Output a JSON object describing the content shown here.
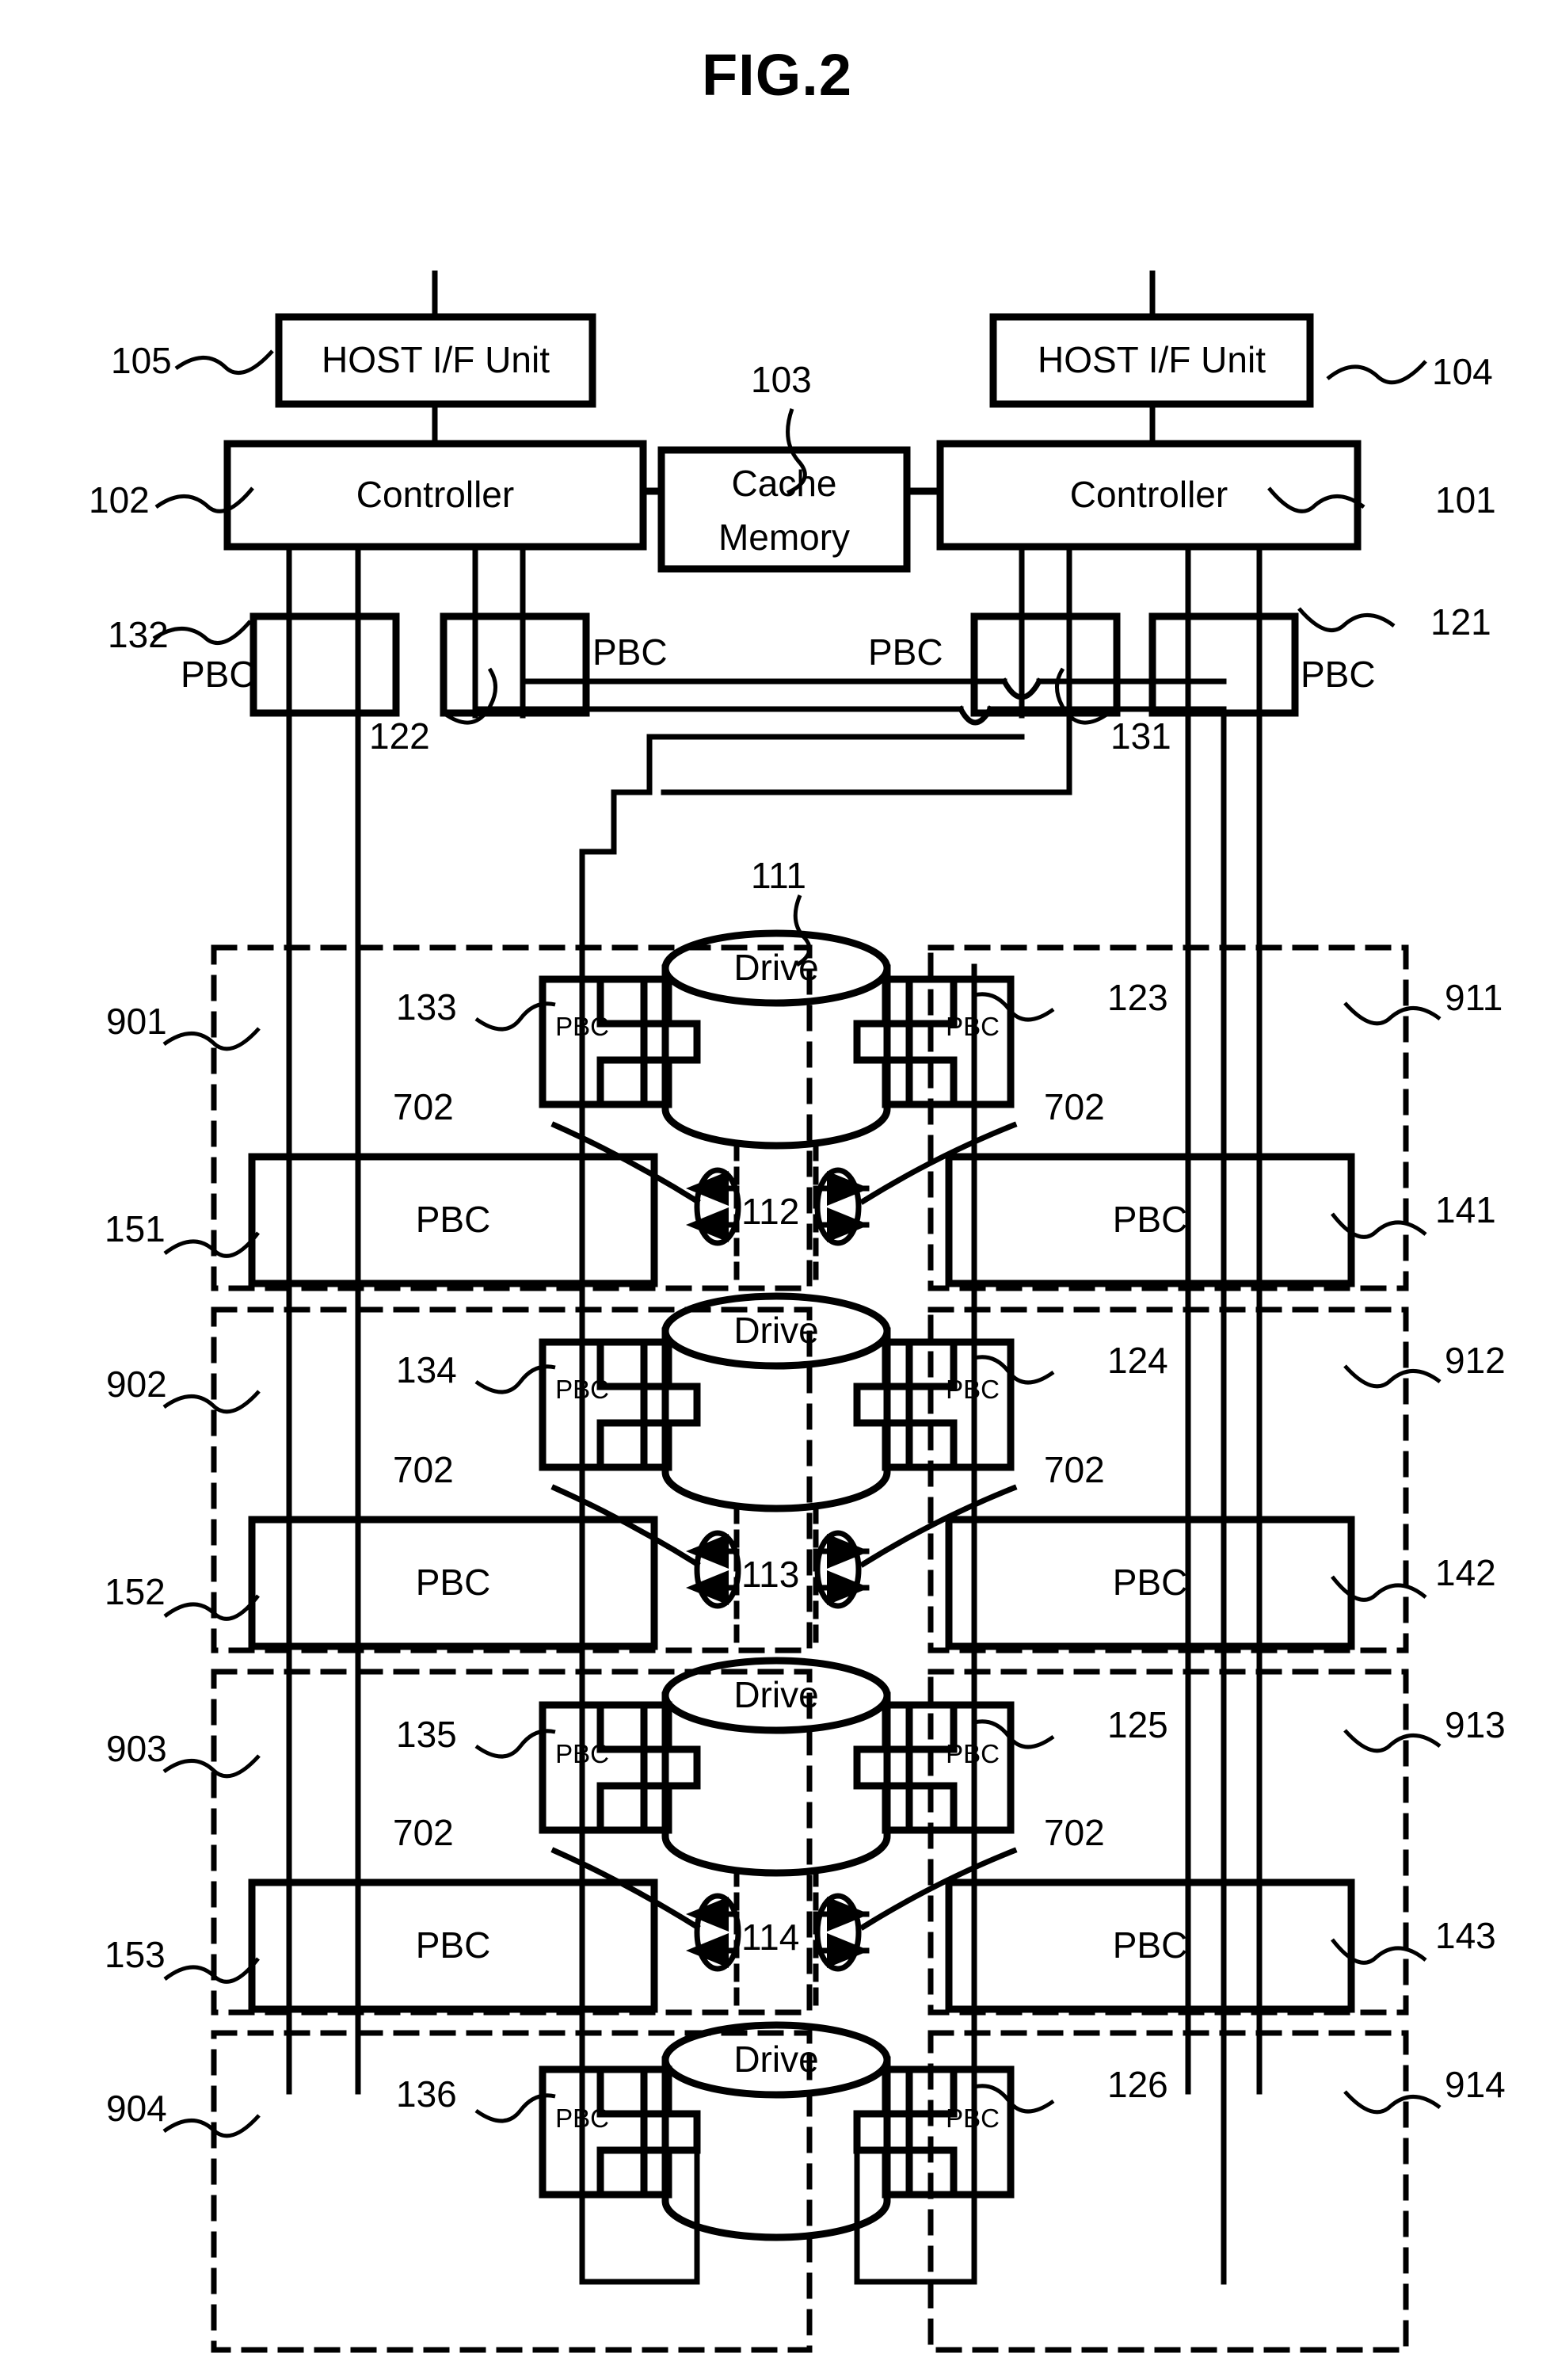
{
  "figure": {
    "title": "FIG.2"
  },
  "top": {
    "host_if_left": {
      "label": "HOST I/F Unit",
      "ref": "105"
    },
    "host_if_right": {
      "label": "HOST I/F Unit",
      "ref": "104"
    },
    "controller_left": {
      "label": "Controller",
      "ref": "102"
    },
    "controller_right": {
      "label": "Controller",
      "ref": "101"
    },
    "cache": {
      "label": "Cache\nMemory",
      "line1": "Cache",
      "line2": "Memory",
      "ref": "103"
    }
  },
  "controller_pbcs": [
    {
      "label": "PBC",
      "ref": "132",
      "side": "left"
    },
    {
      "label": "PBC",
      "ref": "122",
      "side": "left"
    },
    {
      "label": "PBC",
      "ref": "131",
      "side": "right"
    },
    {
      "label": "PBC",
      "ref": "121",
      "side": "right"
    }
  ],
  "drive_groups": [
    {
      "drive": {
        "label": "Drive",
        "ref": "111"
      },
      "left_enclosure_ref": "901",
      "right_enclosure_ref": "911",
      "left_drive_pbc": {
        "label": "PBC",
        "ref": "133"
      },
      "right_drive_pbc": {
        "label": "PBC",
        "ref": "123"
      },
      "left_wide_pbc": {
        "label": "PBC",
        "ref": "151"
      },
      "right_wide_pbc": {
        "label": "PBC",
        "ref": "141"
      },
      "link_ref": "112",
      "port_ref_left": "702",
      "port_ref_right": "702"
    },
    {
      "drive": {
        "label": "Drive",
        "ref": ""
      },
      "left_enclosure_ref": "902",
      "right_enclosure_ref": "912",
      "left_drive_pbc": {
        "label": "PBC",
        "ref": "134"
      },
      "right_drive_pbc": {
        "label": "PBC",
        "ref": "124"
      },
      "left_wide_pbc": {
        "label": "PBC",
        "ref": "152"
      },
      "right_wide_pbc": {
        "label": "PBC",
        "ref": "142"
      },
      "link_ref": "113",
      "port_ref_left": "702",
      "port_ref_right": "702"
    },
    {
      "drive": {
        "label": "Drive",
        "ref": ""
      },
      "left_enclosure_ref": "903",
      "right_enclosure_ref": "913",
      "left_drive_pbc": {
        "label": "PBC",
        "ref": "135"
      },
      "right_drive_pbc": {
        "label": "PBC",
        "ref": "125"
      },
      "left_wide_pbc": {
        "label": "PBC",
        "ref": "153"
      },
      "right_wide_pbc": {
        "label": "PBC",
        "ref": "143"
      },
      "link_ref": "114",
      "port_ref_left": "702",
      "port_ref_right": "702"
    },
    {
      "drive": {
        "label": "Drive",
        "ref": ""
      },
      "left_enclosure_ref": "904",
      "right_enclosure_ref": "914",
      "left_drive_pbc": {
        "label": "PBC",
        "ref": "136"
      },
      "right_drive_pbc": {
        "label": "PBC",
        "ref": "126"
      },
      "left_wide_pbc": null,
      "right_wide_pbc": null,
      "link_ref": "",
      "port_ref_left": "",
      "port_ref_right": ""
    }
  ],
  "colors": {
    "ink": "#000000",
    "paper": "#ffffff"
  }
}
